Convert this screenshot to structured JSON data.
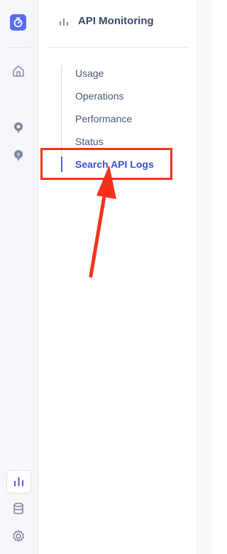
{
  "app": {
    "section_title": "API Monitoring"
  },
  "rail": {
    "icons": [
      "stopwatch-logo-icon",
      "home-icon",
      "map-pin-icon",
      "lightning-pin-icon",
      "bar-chart-icon",
      "database-icon",
      "gear-icon"
    ]
  },
  "nav": {
    "items": [
      {
        "label": "Usage"
      },
      {
        "label": "Operations"
      },
      {
        "label": "Performance"
      },
      {
        "label": "Status"
      },
      {
        "label": "Search API Logs",
        "active": true
      }
    ]
  },
  "colors": {
    "accent": "#5b6cf0",
    "active_text": "#3c4fd6",
    "highlight": "#f4321c"
  }
}
